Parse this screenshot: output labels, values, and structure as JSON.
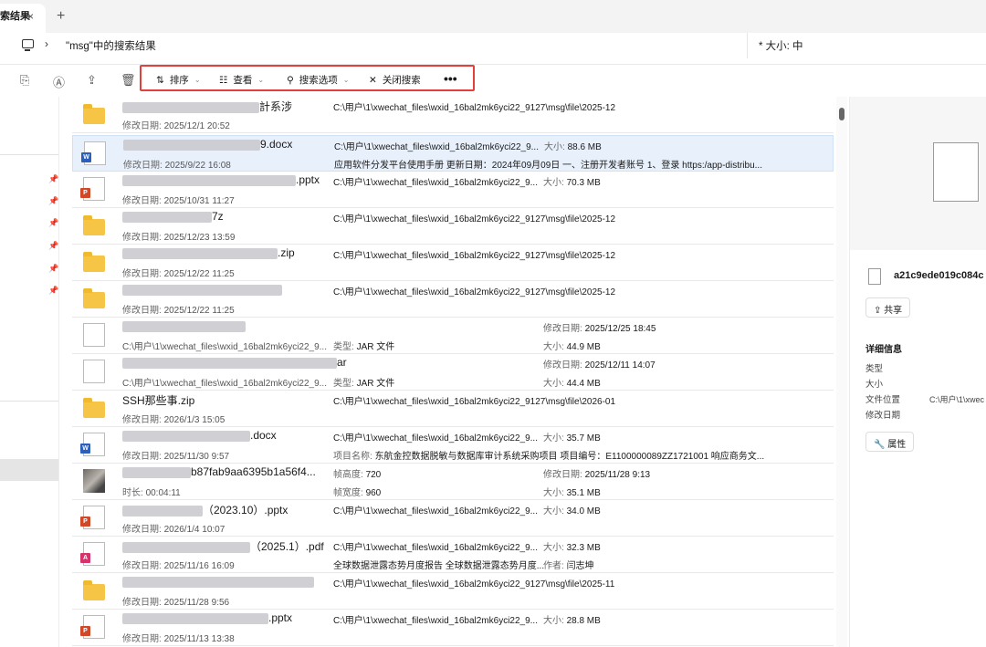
{
  "tab": {
    "title": "索结果",
    "close": "×",
    "add": "+"
  },
  "address": {
    "chevron": "›",
    "path": "\"msg\"中的搜索结果",
    "search": "* 大小: 中"
  },
  "toolbar": {
    "sort": "排序",
    "view": "查看",
    "options": "搜索选项",
    "close_search": "关闭搜索",
    "more": "•••",
    "highlight_color": "#e2403d"
  },
  "labels": {
    "modified": "修改日期:",
    "size": "大小:",
    "type": "类型:",
    "duration": "时长:",
    "height": "帧高度:",
    "width": "帧宽度:",
    "title": "项目名称:",
    "author": "作者:"
  },
  "rows": [
    {
      "icon": "folder",
      "name": "計系涉",
      "date": "2025/12/1 20:52",
      "path": "C:\\用户\\1\\xwechat_files\\wxid_16bal2mk6yci22_9127\\msg\\file\\2025-12"
    },
    {
      "icon": "word",
      "name": "9.docx",
      "date": "2025/9/22 16:08",
      "path": "C:\\用户\\1\\xwechat_files\\wxid_16bal2mk6yci22_9...",
      "size": "88.6 MB",
      "desc": "应用软件分发平台使用手册 更新日期：2024年09月09日 一、注册开发者账号 1、登录 https:/app-distribu..."
    },
    {
      "icon": "ppt",
      "name": ".pptx",
      "date": "2025/10/31 11:27",
      "path": "C:\\用户\\1\\xwechat_files\\wxid_16bal2mk6yci22_9...",
      "size": "70.3 MB"
    },
    {
      "icon": "folder",
      "name": "7z",
      "date": "2025/12/23 13:59",
      "path": "C:\\用户\\1\\xwechat_files\\wxid_16bal2mk6yci22_9127\\msg\\file\\2025-12"
    },
    {
      "icon": "folder",
      "name": ".zip",
      "date": "2025/12/22 11:25",
      "path": "C:\\用户\\1\\xwechat_files\\wxid_16bal2mk6yci22_9127\\msg\\file\\2025-12"
    },
    {
      "icon": "folder",
      "name": "",
      "date": "2025/12/22 11:25",
      "path": "C:\\用户\\1\\xwechat_files\\wxid_16bal2mk6yci22_9127\\msg\\file\\2025-12"
    },
    {
      "icon": "blank",
      "name": "",
      "sub": "C:\\用户\\1\\xwechat_files\\wxid_16bal2mk6yci22_9...",
      "type": "JAR 文件",
      "mdate": "2025/12/25 18:45",
      "size2": "44.9 MB"
    },
    {
      "icon": "blank",
      "name": "ar",
      "sub": "C:\\用户\\1\\xwechat_files\\wxid_16bal2mk6yci22_9...",
      "type": "JAR 文件",
      "mdate": "2025/12/11 14:07",
      "size2": "44.4 MB"
    },
    {
      "icon": "folder",
      "name": "SSH那些事.zip",
      "date": "2026/1/3 15:05",
      "path": "C:\\用户\\1\\xwechat_files\\wxid_16bal2mk6yci22_9127\\msg\\file\\2026-01"
    },
    {
      "icon": "word",
      "name": ".docx",
      "date": "2025/11/30 9:57",
      "path": "C:\\用户\\1\\xwechat_files\\wxid_16bal2mk6yci22_9...",
      "size": "35.7 MB",
      "desc2": "东航金控数据脱敏与数据库审计系统采购项目 项目编号：E1100000089ZZ1721001 响应商务文..."
    },
    {
      "icon": "video",
      "name": "b87fab9aa6395b1a56f4...",
      "duration": "00:04:11",
      "height": "720",
      "width": "960",
      "mdate": "2025/11/28 9:13",
      "size2": "35.1 MB"
    },
    {
      "icon": "ppt",
      "name": "（2023.10）.pptx",
      "date": "2026/1/4 10:07",
      "path": "C:\\用户\\1\\xwechat_files\\wxid_16bal2mk6yci22_9...",
      "size": "34.0 MB"
    },
    {
      "icon": "pdf",
      "name": "（2025.1）.pdf",
      "date": "2025/11/16 16:09",
      "path": "C:\\用户\\1\\xwechat_files\\wxid_16bal2mk6yci22_9...",
      "size": "32.3 MB",
      "desc3": "全球数据泄露态势月度报告 全球数据泄露态势月度...",
      "author": "闫志坤"
    },
    {
      "icon": "folder",
      "name": "",
      "date": "2025/11/28 9:56",
      "path": "C:\\用户\\1\\xwechat_files\\wxid_16bal2mk6yci22_9127\\msg\\file\\2025-11"
    },
    {
      "icon": "ppt",
      "name": ".pptx",
      "date": "2025/11/13 13:38",
      "path": "C:\\用户\\1\\xwechat_files\\wxid_16bal2mk6yci22_9...",
      "size": "28.8 MB"
    }
  ],
  "details": {
    "filename": "a21c9ede019c084c",
    "share": "共享",
    "heading": "详细信息",
    "type": "类型",
    "size": "大小",
    "location": "文件位置",
    "location_val": "C:\\用户\\1\\xwec",
    "modified": "修改日期",
    "props": "属性"
  }
}
